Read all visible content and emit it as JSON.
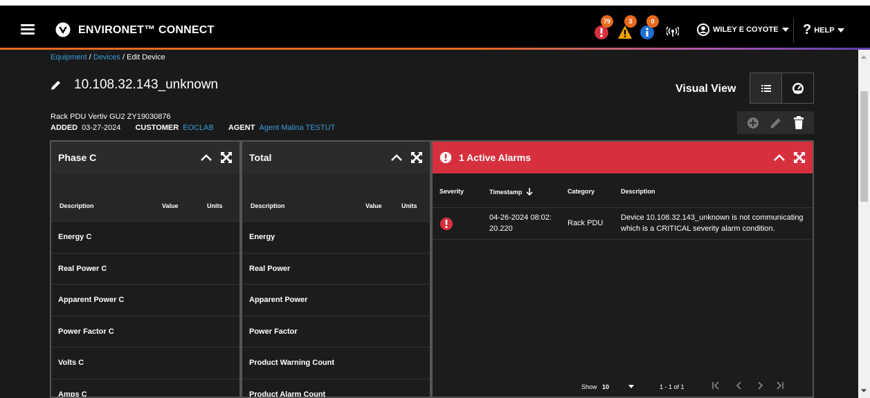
{
  "header": {
    "brand": "ENVIRONET™ CONNECT",
    "notifications": [
      {
        "icon": "critical-alert-icon",
        "count": "79",
        "color": "#d6303f"
      },
      {
        "icon": "warning-alert-icon",
        "count": "3",
        "color": "#f0a202"
      },
      {
        "icon": "info-alert-icon",
        "count": "0",
        "color": "#1b6fd1"
      }
    ],
    "user_name": "WILEY E COYOTE",
    "help_label": "HELP"
  },
  "breadcrumb": {
    "items": [
      "Equipment",
      "Devices",
      "Edit Device"
    ],
    "separator": "/"
  },
  "device": {
    "title": "10.108.32.143_unknown",
    "description": "Rack PDU  Vertiv  GU2  ZY19030876",
    "added_label": "ADDED",
    "added_value": "03-27-2024",
    "customer_label": "CUSTOMER",
    "customer_value": "EOCLAB",
    "agent_label": "AGENT",
    "agent_value": "Agent Malina TESTUT"
  },
  "view": {
    "label": "Visual View"
  },
  "phase_panel": {
    "title": "Phase C",
    "columns": [
      "Description",
      "Value",
      "Units"
    ],
    "rows": [
      "Energy C",
      "Real Power C",
      "Apparent Power C",
      "Power Factor C",
      "Volts C",
      "Amps C"
    ]
  },
  "total_panel": {
    "title": "Total",
    "columns": [
      "Description",
      "Value",
      "Units"
    ],
    "rows": [
      "Energy",
      "Real Power",
      "Apparent Power",
      "Power Factor",
      "Product Warning Count",
      "Product Alarm Count"
    ]
  },
  "alarm_panel": {
    "title": "1 Active Alarms",
    "columns": [
      "Severity",
      "Timestamp",
      "Category",
      "Description"
    ],
    "alarms": [
      {
        "timestamp_line1": "04-26-2024 08:02:",
        "timestamp_line2": "20.220",
        "category": "Rack PDU",
        "description_line1": "Device 10.108.32.143_unknown is not communicating",
        "description_line2": "which is a CRITICAL severity alarm condition."
      }
    ],
    "pager": {
      "show_label": "Show",
      "show_value": "10",
      "range": "1 - 1 of 1"
    }
  },
  "colors": {
    "accent_orange": "#e96a1e",
    "link_blue": "#3c9bd9",
    "alarm_red": "#d6303f"
  }
}
